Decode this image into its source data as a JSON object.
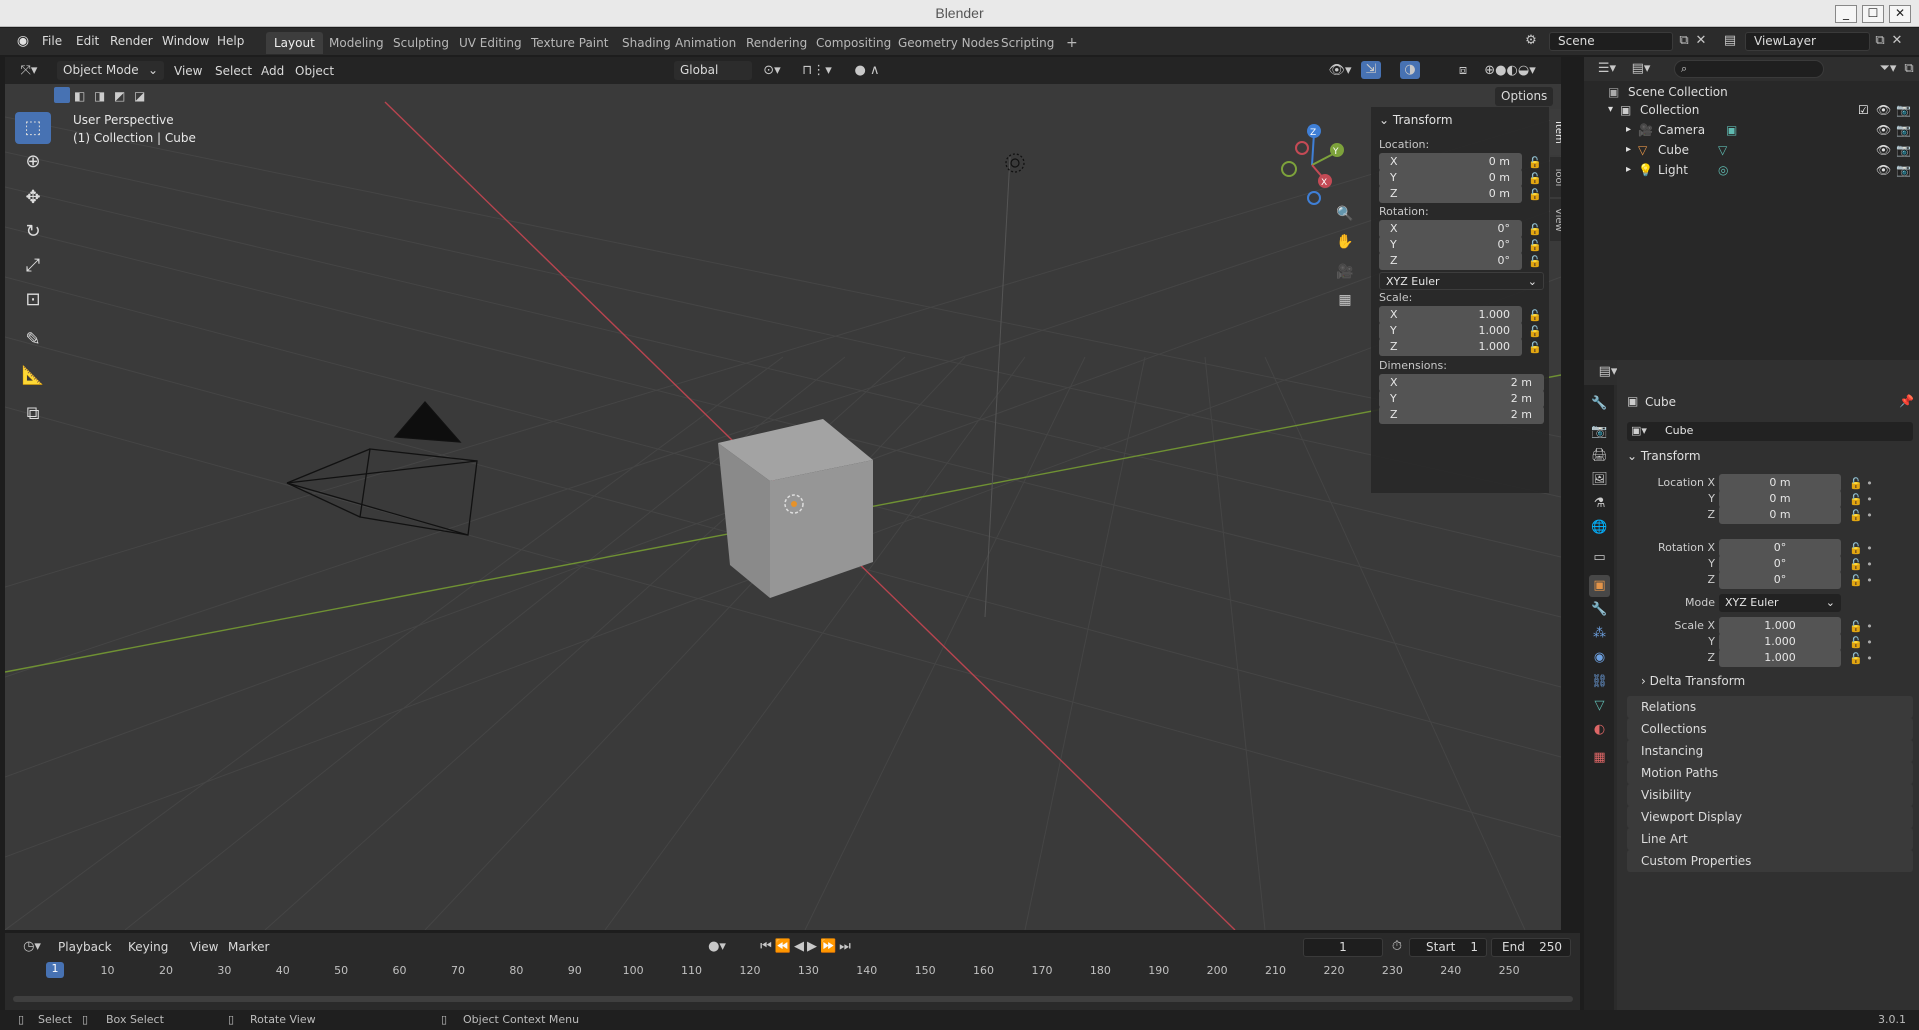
{
  "window": {
    "title": "Blender",
    "min": "_",
    "max": "☐",
    "close": "✕"
  },
  "menus": [
    "File",
    "Edit",
    "Render",
    "Window",
    "Help"
  ],
  "workspaces": [
    "Layout",
    "Modeling",
    "Sculpting",
    "UV Editing",
    "Texture Paint",
    "Shading",
    "Animation",
    "Rendering",
    "Compositing",
    "Geometry Nodes",
    "Scripting",
    "+"
  ],
  "scene": {
    "name": "Scene",
    "viewlayer": "ViewLayer"
  },
  "viewport_header": {
    "mode": "Object Mode",
    "menus": [
      "View",
      "Select",
      "Add",
      "Object"
    ],
    "orientation": "Global",
    "options": "Options"
  },
  "viewport_overlay": {
    "perspective": "User Perspective",
    "context": "(1) Collection | Cube"
  },
  "gizmo": {
    "z": "Z",
    "y": "Y",
    "x": "X"
  },
  "npanel": {
    "title": "Transform",
    "location_label": "Location:",
    "rotation_label": "Rotation:",
    "scale_label": "Scale:",
    "dimensions_label": "Dimensions:",
    "axes": [
      "X",
      "Y",
      "Z"
    ],
    "location": [
      "0 m",
      "0 m",
      "0 m"
    ],
    "rotation": [
      "0°",
      "0°",
      "0°"
    ],
    "rotation_mode": "XYZ Euler",
    "scale": [
      "1.000",
      "1.000",
      "1.000"
    ],
    "dimensions": [
      "2 m",
      "2 m",
      "2 m"
    ],
    "tabs": [
      "Item",
      "Tool",
      "View"
    ]
  },
  "outliner": {
    "scene_collection": "Scene Collection",
    "collection": "Collection",
    "items": [
      "Camera",
      "Cube",
      "Light"
    ]
  },
  "properties": {
    "object_name": "Cube",
    "object_field": "Cube",
    "transform_title": "Transform",
    "location_labels": [
      "Location X",
      "Y",
      "Z"
    ],
    "location": [
      "0 m",
      "0 m",
      "0 m"
    ],
    "rotation_labels": [
      "Rotation X",
      "Y",
      "Z"
    ],
    "rotation": [
      "0°",
      "0°",
      "0°"
    ],
    "mode_label": "Mode",
    "mode_value": "XYZ Euler",
    "scale_labels": [
      "Scale X",
      "Y",
      "Z"
    ],
    "scale": [
      "1.000",
      "1.000",
      "1.000"
    ],
    "delta": "Delta Transform",
    "sections": [
      "Relations",
      "Collections",
      "Instancing",
      "Motion Paths",
      "Visibility",
      "Viewport Display",
      "Line Art",
      "Custom Properties"
    ]
  },
  "timeline": {
    "menus": [
      "Playback",
      "Keying",
      "View",
      "Marker"
    ],
    "current_frame": "1",
    "start_label": "Start",
    "start": "1",
    "end_label": "End",
    "end": "250",
    "ticks": [
      "1",
      "10",
      "20",
      "30",
      "40",
      "50",
      "60",
      "70",
      "80",
      "90",
      "100",
      "110",
      "120",
      "130",
      "140",
      "150",
      "160",
      "170",
      "180",
      "190",
      "200",
      "210",
      "220",
      "230",
      "240",
      "250"
    ]
  },
  "statusbar": {
    "select": "Select",
    "box_select": "Box Select",
    "rotate": "Rotate View",
    "context_menu": "Object Context Menu",
    "version": "3.0.1"
  },
  "colors": {
    "accent": "#4772b3",
    "x_axis": "#c44a55",
    "y_axis": "#7da23b",
    "z_axis": "#3f7fd6"
  }
}
